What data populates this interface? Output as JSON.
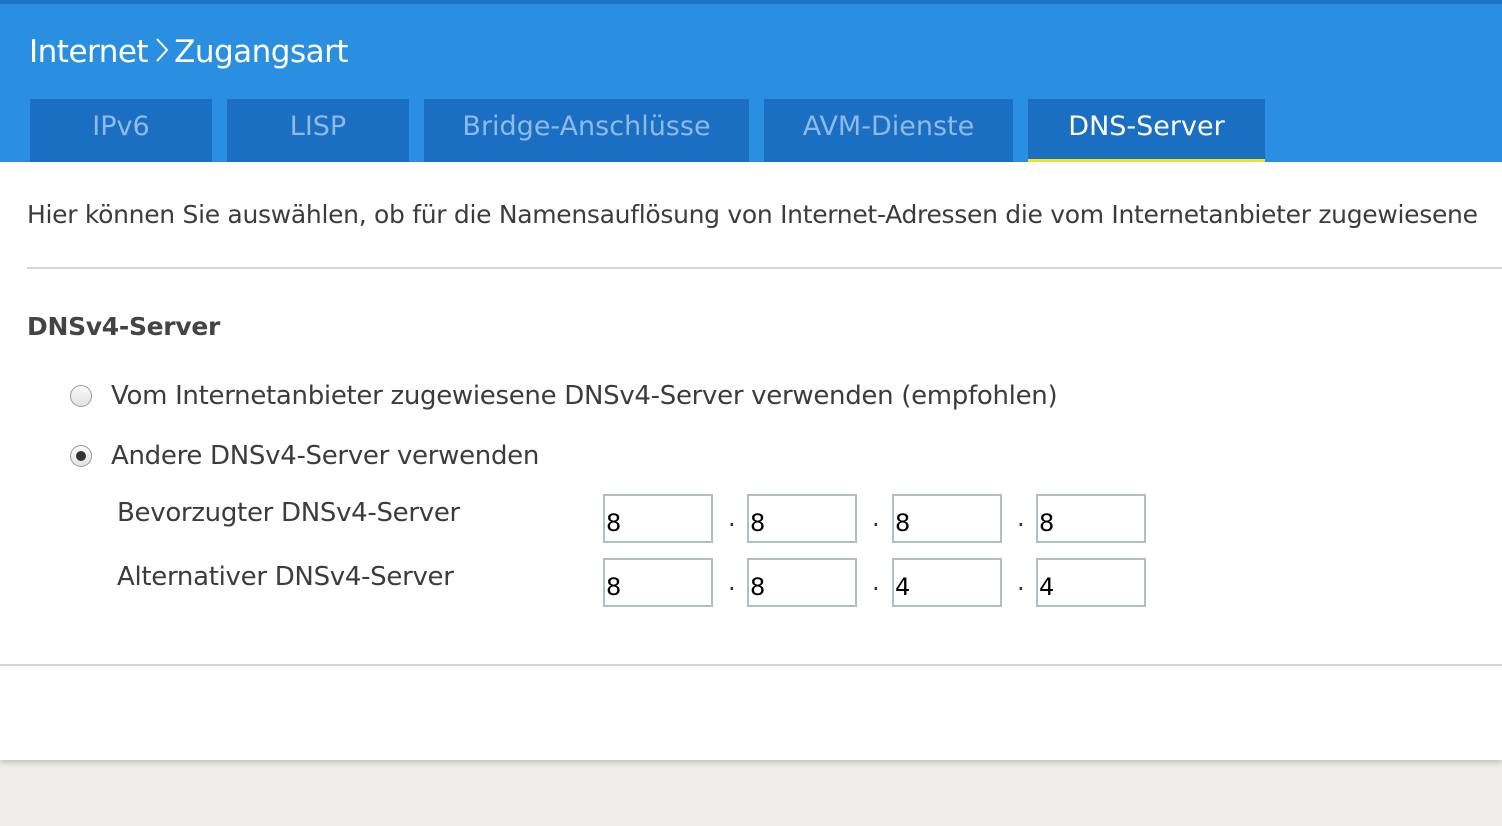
{
  "header": {
    "breadcrumb": {
      "parent": "Internet",
      "current": "Zugangsart"
    },
    "tabs": [
      {
        "label": "IPv6",
        "active": false
      },
      {
        "label": "LISP",
        "active": false
      },
      {
        "label": "Bridge-Anschlüsse",
        "active": false
      },
      {
        "label": "AVM-Dienste",
        "active": false
      },
      {
        "label": "DNS-Server",
        "active": true
      }
    ],
    "colors": {
      "header_bg": "#2a8fe0",
      "tab_bg": "#1a6fc2",
      "active_tab_underline": "#f6e321"
    }
  },
  "content": {
    "intro": "Hier können Sie auswählen, ob für die Namensauflösung von Internet-Adressen die vom Internetanbieter zugewiesene",
    "dnsv4": {
      "title": "DNSv4-Server",
      "options": [
        {
          "label": "Vom Internetanbieter zugewiesene DNSv4-Server verwenden (empfohlen)",
          "checked": false
        },
        {
          "label": "Andere DNSv4-Server verwenden",
          "checked": true
        }
      ],
      "preferred": {
        "label": "Bevorzugter DNSv4-Server",
        "octets": [
          "8",
          "8",
          "8",
          "8"
        ]
      },
      "alternate": {
        "label": "Alternativer DNSv4-Server",
        "octets": [
          "8",
          "8",
          "4",
          "4"
        ]
      },
      "separator": "."
    }
  }
}
